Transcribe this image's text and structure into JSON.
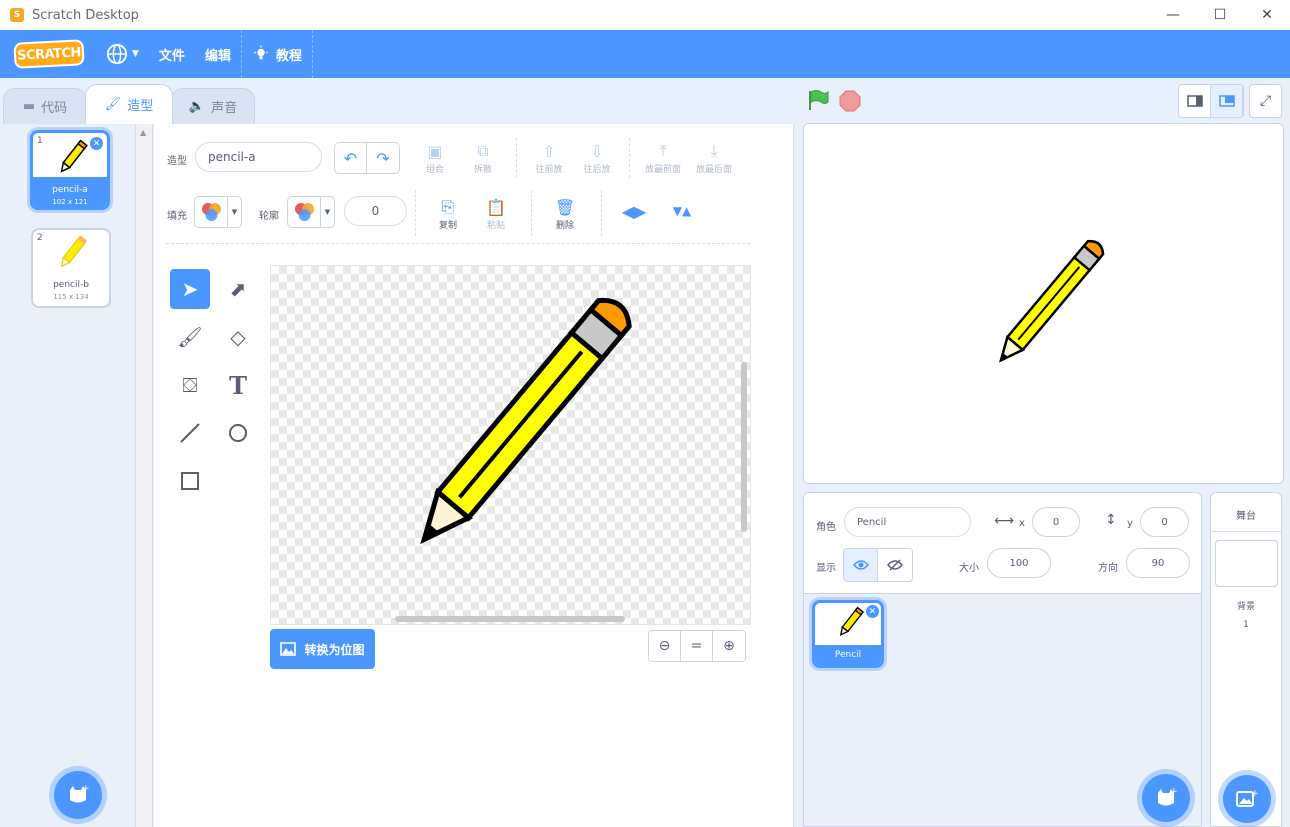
{
  "window": {
    "title": "Scratch Desktop",
    "minimize": "—",
    "maximize": "☐",
    "close": "✕"
  },
  "menubar": {
    "logo": "SCRATCH",
    "file": "文件",
    "edit": "编辑",
    "tutorials": "教程"
  },
  "tabs": {
    "code": "代码",
    "costumes": "造型",
    "sounds": "声音"
  },
  "costumes": [
    {
      "num": "1",
      "name": "pencil-a",
      "size": "102 x 121"
    },
    {
      "num": "2",
      "name": "pencil-b",
      "size": "115 x 134"
    }
  ],
  "editor": {
    "costume_label": "造型",
    "costume_name": "pencil-a",
    "fill_label": "填充",
    "outline_label": "轮廓",
    "outline_width": "0",
    "group": "组合",
    "ungroup": "拆散",
    "forward": "往前放",
    "backward": "往后放",
    "front": "放最前面",
    "back": "放最后面",
    "copy": "复制",
    "paste": "粘贴",
    "delete": "删除",
    "convert": "转换为位图",
    "zoom_reset": "="
  },
  "sprite": {
    "sprite_label": "角色",
    "name": "Pencil",
    "x_label": "x",
    "x": "0",
    "y_label": "y",
    "y": "0",
    "show_label": "显示",
    "size_label": "大小",
    "size": "100",
    "direction_label": "方向",
    "direction": "90",
    "thumb_name": "Pencil"
  },
  "stage_pane": {
    "title": "舞台",
    "backdrops_label": "背景",
    "backdrops_count": "1"
  },
  "colors": {
    "accent": "#4c97ff",
    "orange": "#ffab19",
    "pencil": "#ffff00"
  }
}
